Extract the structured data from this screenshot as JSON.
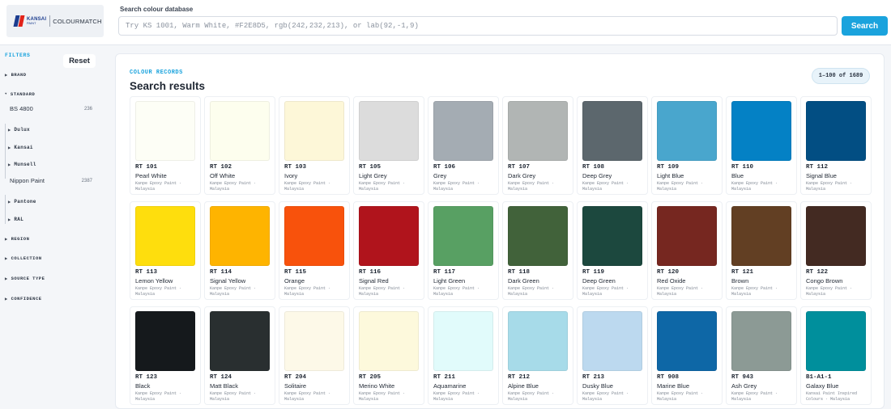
{
  "header": {
    "logo": {
      "brand_line1": "KANSAI",
      "brand_line2": "PAINT",
      "app_name": "COLOURMATCH"
    },
    "search_label": "Search colour database",
    "search_placeholder": "Try KS 1001, Warm White, #F2E8D5, rgb(242,232,213), or lab(92,-1,9)",
    "search_value": "",
    "search_button": "Search",
    "accent_color": "#1aa3dd"
  },
  "sidebar": {
    "title": "FILTERS",
    "reset_label": "Reset",
    "sections": {
      "brand": "BRAND",
      "standard": "STANDARD",
      "bs4800": {
        "label": "BS 4800",
        "count": "236"
      },
      "dulux": "Dulux",
      "kansai": "Kansai",
      "munsell": "Munsell",
      "nippon": {
        "label": "Nippon Paint",
        "count": "2387"
      },
      "pantone": "Pantone",
      "ral": "RAL",
      "region": "REGION",
      "collection": "COLLECTION",
      "source_type": "SOURCE TYPE",
      "confidence": "CONFIDENCE"
    }
  },
  "main": {
    "section_label": "COLOUR RECORDS",
    "title": "Search results",
    "range": "1–100 of 1689",
    "cards": [
      {
        "code": "RT 101",
        "name": "Pearl White",
        "source": "Kanpe Epoxy Paint · Malaysia",
        "color": "#fdfef6"
      },
      {
        "code": "RT 102",
        "name": "Off White",
        "source": "Kanpe Epoxy Paint · Malaysia",
        "color": "#fdfeee"
      },
      {
        "code": "RT 103",
        "name": "Ivory",
        "source": "Kanpe Epoxy Paint · Malaysia",
        "color": "#fdf7d8"
      },
      {
        "code": "RT 105",
        "name": "Light Grey",
        "source": "Kanpe Epoxy Paint · Malaysia",
        "color": "#dcdcdc"
      },
      {
        "code": "RT 106",
        "name": "Grey",
        "source": "Kanpe Epoxy Paint · Malaysia",
        "color": "#a4acb3"
      },
      {
        "code": "RT 107",
        "name": "Dark Grey",
        "source": "Kanpe Epoxy Paint · Malaysia",
        "color": "#b1b5b4"
      },
      {
        "code": "RT 108",
        "name": "Deep Grey",
        "source": "Kanpe Epoxy Paint · Malaysia",
        "color": "#5c676d"
      },
      {
        "code": "RT 109",
        "name": "Light Blue",
        "source": "Kanpe Epoxy Paint · Malaysia",
        "color": "#49a6cd"
      },
      {
        "code": "RT 110",
        "name": "Blue",
        "source": "Kanpe Epoxy Paint · Malaysia",
        "color": "#0481c5"
      },
      {
        "code": "RT 112",
        "name": "Signal Blue",
        "source": "Kanpe Epoxy Paint · Malaysia",
        "color": "#024e83"
      },
      {
        "code": "RT 113",
        "name": "Lemon Yellow",
        "source": "Kanpe Epoxy Paint · Malaysia",
        "color": "#fede0d"
      },
      {
        "code": "RT 114",
        "name": "Signal Yellow",
        "source": "Kanpe Epoxy Paint · Malaysia",
        "color": "#feb400"
      },
      {
        "code": "RT 115",
        "name": "Orange",
        "source": "Kanpe Epoxy Paint · Malaysia",
        "color": "#f8520c"
      },
      {
        "code": "RT 116",
        "name": "Signal Red",
        "source": "Kanpe Epoxy Paint · Malaysia",
        "color": "#b0141c"
      },
      {
        "code": "RT 117",
        "name": "Light Green",
        "source": "Kanpe Epoxy Paint · Malaysia",
        "color": "#58a063"
      },
      {
        "code": "RT 118",
        "name": "Dark Green",
        "source": "Kanpe Epoxy Paint · Malaysia",
        "color": "#41623a"
      },
      {
        "code": "RT 119",
        "name": "Deep Green",
        "source": "Kanpe Epoxy Paint · Malaysia",
        "color": "#1c483e"
      },
      {
        "code": "RT 120",
        "name": "Red Oxide",
        "source": "Kanpe Epoxy Paint · Malaysia",
        "color": "#762720"
      },
      {
        "code": "RT 121",
        "name": "Brown",
        "source": "Kanpe Epoxy Paint · Malaysia",
        "color": "#623f23"
      },
      {
        "code": "RT 122",
        "name": "Congo Brown",
        "source": "Kanpe Epoxy Paint · Malaysia",
        "color": "#432a22"
      },
      {
        "code": "RT 123",
        "name": "Black",
        "source": "Kanpe Epoxy Paint · Malaysia",
        "color": "#15191c"
      },
      {
        "code": "RT 124",
        "name": "Matt Black",
        "source": "Kanpe Epoxy Paint · Malaysia",
        "color": "#292f30"
      },
      {
        "code": "RT 204",
        "name": "Solitaire",
        "source": "Kanpe Epoxy Paint · Malaysia",
        "color": "#fdf9e8"
      },
      {
        "code": "RT 205",
        "name": "Merino White",
        "source": "Kanpe Epoxy Paint · Malaysia",
        "color": "#fdf9dc"
      },
      {
        "code": "RT 211",
        "name": "Aquamarine",
        "source": "Kanpe Epoxy Paint · Malaysia",
        "color": "#e1fbfb"
      },
      {
        "code": "RT 212",
        "name": "Alpine Blue",
        "source": "Kanpe Epoxy Paint · Malaysia",
        "color": "#a7dbe9"
      },
      {
        "code": "RT 213",
        "name": "Dusky Blue",
        "source": "Kanpe Epoxy Paint · Malaysia",
        "color": "#bcd9ef"
      },
      {
        "code": "RT 908",
        "name": "Marine Blue",
        "source": "Kanpe Epoxy Paint · Malaysia",
        "color": "#0e67a6"
      },
      {
        "code": "RT 943",
        "name": "Ash Grey",
        "source": "Kanpe Epoxy Paint · Malaysia",
        "color": "#8c9a95"
      },
      {
        "code": "B1-A1-1",
        "name": "Galaxy Blue",
        "source": "Kansai Paint Inspired Colours · Malaysia",
        "color": "#008f9c"
      }
    ]
  }
}
